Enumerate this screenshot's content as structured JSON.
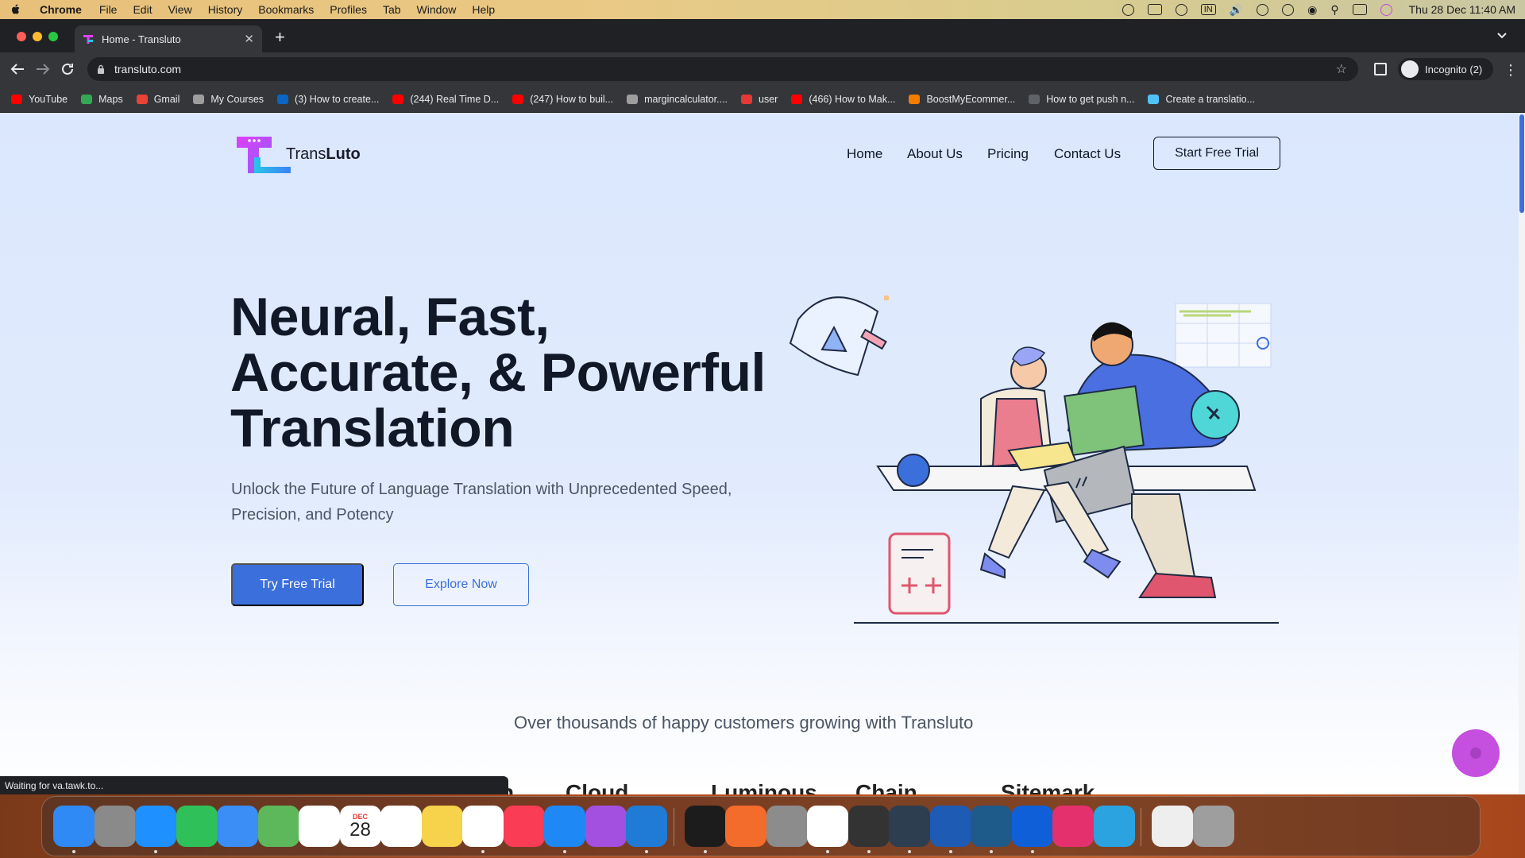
{
  "menubar": {
    "app": "Chrome",
    "items": [
      "File",
      "Edit",
      "View",
      "History",
      "Bookmarks",
      "Profiles",
      "Tab",
      "Window",
      "Help"
    ],
    "input_badge": "IN",
    "clock": "Thu 28 Dec  11:40 AM"
  },
  "browser": {
    "tab_title": "Home - Transluto",
    "url": "transluto.com",
    "incognito_label": "Incognito (2)",
    "bookmarks": [
      {
        "label": "YouTube",
        "color": "#ff0000"
      },
      {
        "label": "Maps",
        "color": "#34a853"
      },
      {
        "label": "Gmail",
        "color": "#ea4335"
      },
      {
        "label": "My Courses",
        "color": "#9e9e9e"
      },
      {
        "label": "(3) How to create...",
        "color": "#0a66c2"
      },
      {
        "label": "(244) Real Time D...",
        "color": "#ff0000"
      },
      {
        "label": "(247) How to buil...",
        "color": "#ff0000"
      },
      {
        "label": "margincalculator....",
        "color": "#9e9e9e"
      },
      {
        "label": "user",
        "color": "#e53935"
      },
      {
        "label": "(466) How to Mak...",
        "color": "#ff0000"
      },
      {
        "label": "BoostMyEcommer...",
        "color": "#f57c00"
      },
      {
        "label": "How to get push n...",
        "color": "#5f6368"
      },
      {
        "label": "Create a translatio...",
        "color": "#4fc3f7"
      }
    ],
    "status": "Waiting for va.tawk.to..."
  },
  "site": {
    "logo_text_light": "Trans",
    "logo_text_bold": "Luto",
    "nav": [
      "Home",
      "About Us",
      "Pricing",
      "Contact Us"
    ],
    "cta_top": "Start Free Trial",
    "hero_title_lines": [
      "Neural, Fast,",
      "Accurate, & Powerful",
      "Translation"
    ],
    "hero_subtitle": "Unlock the Future of Language Translation with Unprecedented Speed, Precision, and Potency",
    "btn_primary": "Try Free Trial",
    "btn_secondary": "Explore Now",
    "customers_text": "Over thousands of happy customers growing with Transluto",
    "partners": [
      "h",
      "Cloud",
      "Luminous",
      "Chain",
      "Sitemark"
    ],
    "colors": {
      "accent": "#3b6fdb",
      "logo_magenta": "#e040fb",
      "logo_cyan": "#29c6e6",
      "chat": "#c54fdf"
    }
  },
  "dock": {
    "calendar_month": "DEC",
    "calendar_day": "28",
    "apps": [
      "Finder",
      "Launchpad",
      "Safari",
      "Messages",
      "Mail",
      "Maps",
      "Photos",
      "Calendar",
      "Reminders",
      "Notes",
      "Freeform",
      "Music",
      "App Store",
      "Podcasts",
      "VS Code",
      "Terminal",
      "Pages Editor",
      "System Settings",
      "Chrome",
      "Keychain",
      "ChatGPT",
      "Word",
      "MySQL Workbench",
      "TeamViewer",
      "Creative Cloud",
      "Telegram",
      "Document",
      "Trash"
    ]
  }
}
